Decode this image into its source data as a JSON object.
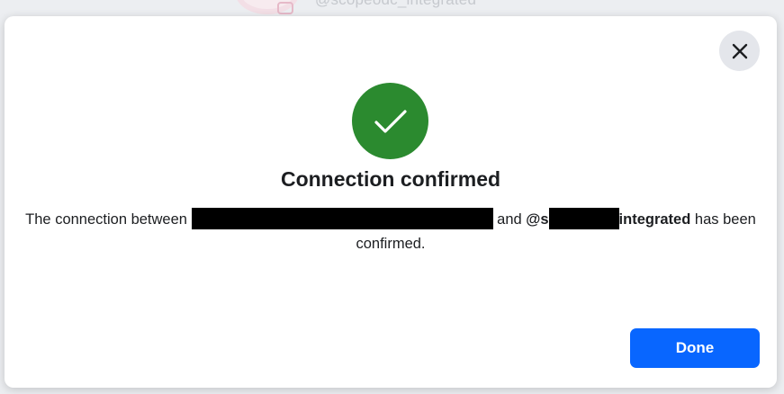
{
  "background": {
    "handle_text": "@scopeodc_integrated"
  },
  "modal": {
    "title": "Connection confirmed",
    "message": {
      "prefix": "The connection between",
      "connector": "and",
      "handle_start": "@s",
      "handle_end": "integrated",
      "suffix": "has been confirmed."
    },
    "done_label": "Done",
    "close_icon": "close-icon",
    "status_icon": "checkmark-icon"
  },
  "colors": {
    "success_green": "#2b8a2f",
    "primary_blue": "#0866ff",
    "close_bg": "#e4e6eb",
    "text": "#1c1e21"
  }
}
